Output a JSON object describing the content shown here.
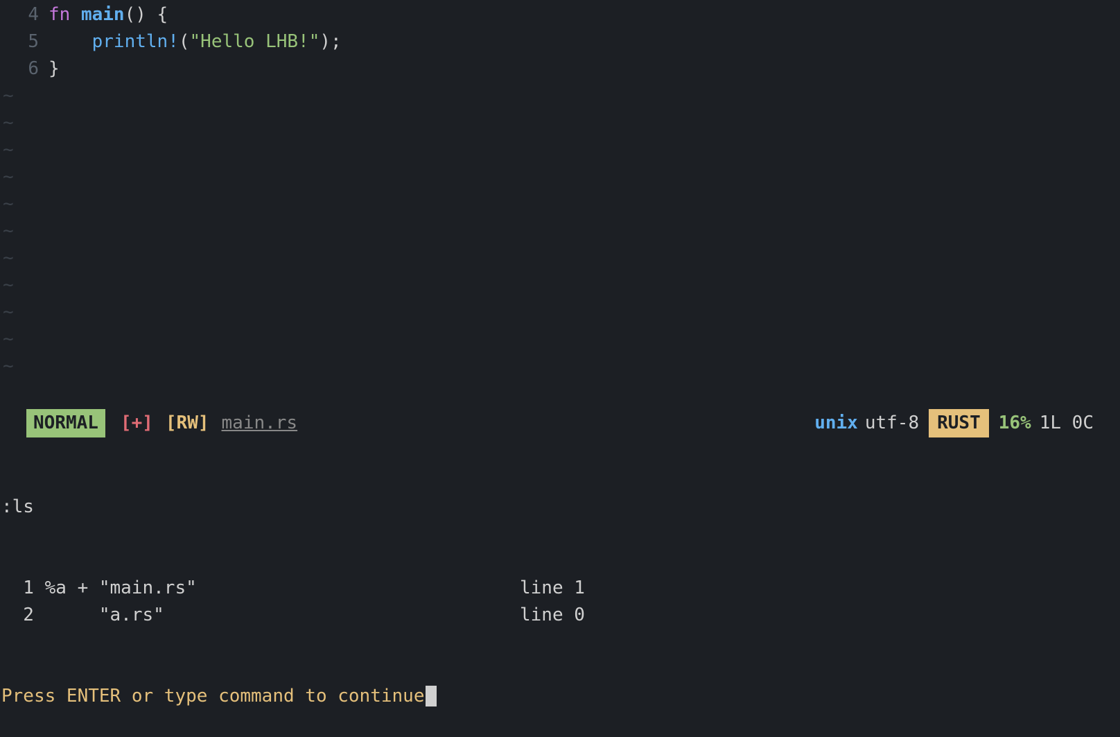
{
  "code": {
    "lines": [
      {
        "num": "4",
        "tokens": [
          {
            "cls": "kw",
            "t": "fn "
          },
          {
            "cls": "fn",
            "t": "main"
          },
          {
            "cls": "paren",
            "t": "() {"
          }
        ]
      },
      {
        "num": "5",
        "tokens": [
          {
            "cls": "",
            "t": "    "
          },
          {
            "cls": "macro",
            "t": "println!"
          },
          {
            "cls": "paren",
            "t": "("
          },
          {
            "cls": "str",
            "t": "\"Hello LHB!\""
          },
          {
            "cls": "paren",
            "t": ");"
          }
        ]
      },
      {
        "num": "6",
        "tokens": [
          {
            "cls": "paren",
            "t": "}"
          }
        ]
      }
    ],
    "tilde": "~",
    "tilde_count": 11
  },
  "status": {
    "mode": "NORMAL",
    "modified": "[+]",
    "rw": "[RW]",
    "file": "main.rs",
    "format": "unix",
    "encoding": "utf-8",
    "lang": "RUST",
    "percent": "16%",
    "pos": "1L 0C"
  },
  "command": {
    "cmd": ":ls",
    "buffers": [
      {
        "left": "  1 %a + \"main.rs\"",
        "right": "line 1"
      },
      {
        "left": "  2      \"a.rs\"",
        "right": "line 0"
      }
    ],
    "prompt": "Press ENTER or type command to continue"
  }
}
